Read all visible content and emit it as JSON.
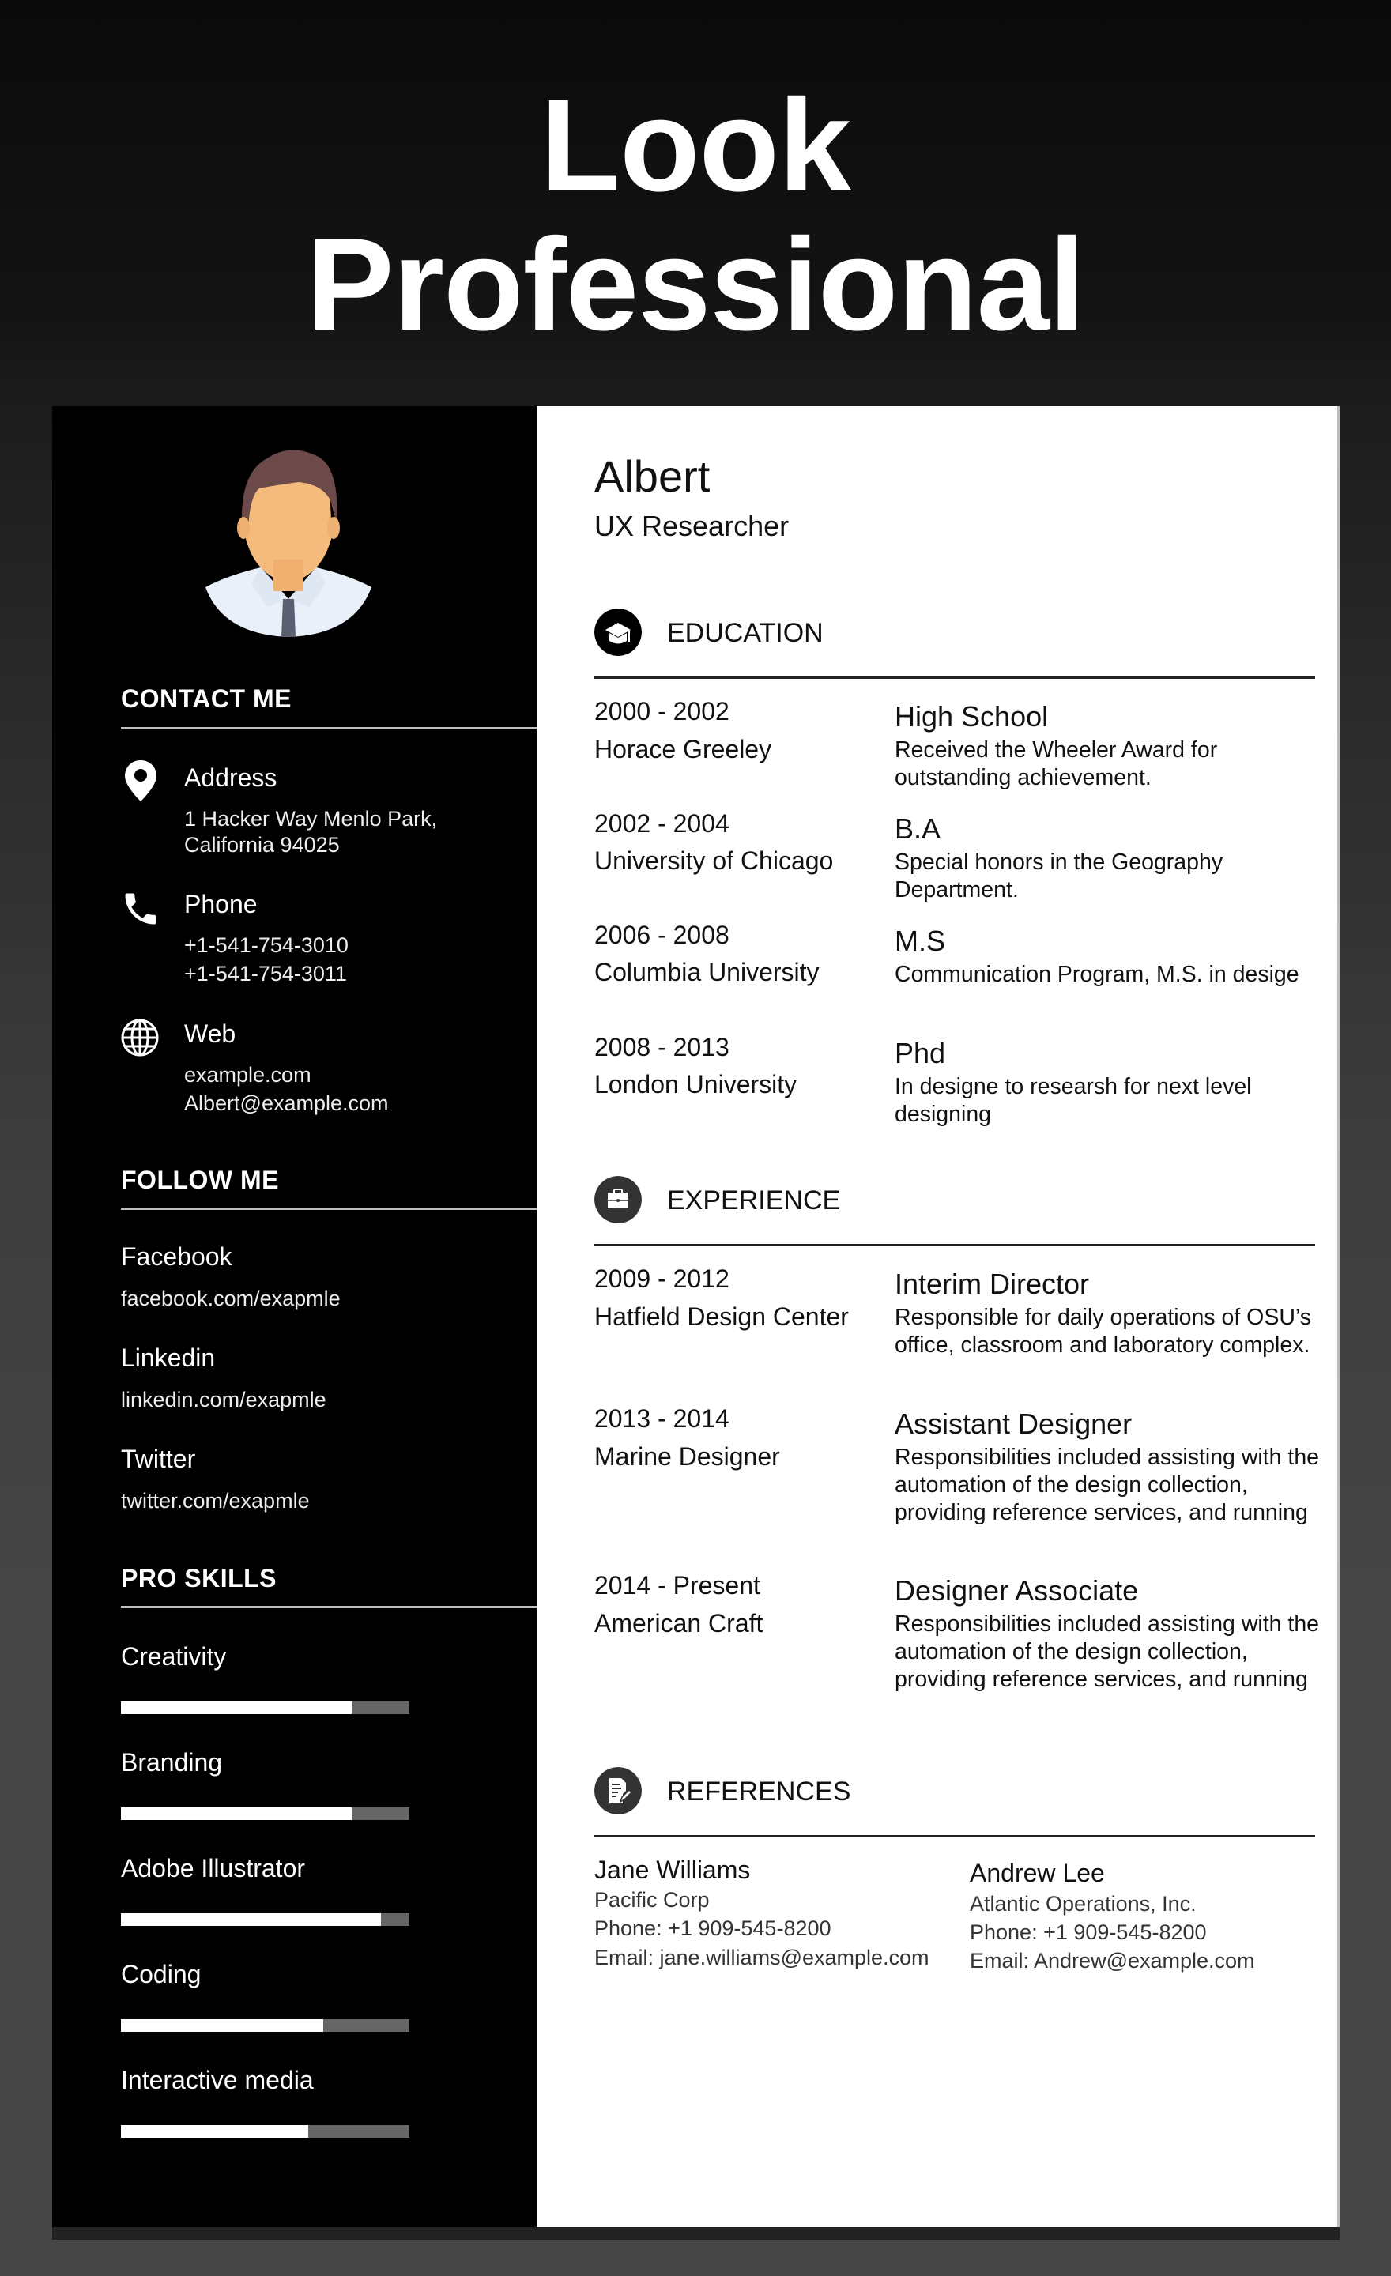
{
  "hero": {
    "line1": "Look",
    "line2": "Professional"
  },
  "profile": {
    "name": "Albert",
    "role": "UX Researcher",
    "avatar_icon": "person-avatar-icon"
  },
  "contact": {
    "heading": "CONTACT ME",
    "address": {
      "icon": "map-pin-icon",
      "label": "Address",
      "lines": [
        "1 Hacker Way Menlo Park,",
        "California 94025"
      ]
    },
    "phone": {
      "icon": "phone-icon",
      "label": "Phone",
      "lines": [
        "+1-541-754-3010",
        "+1-541-754-3011"
      ]
    },
    "web": {
      "icon": "globe-icon",
      "label": "Web",
      "lines": [
        "example.com",
        "Albert@example.com"
      ]
    }
  },
  "follow": {
    "heading": "FOLLOW ME",
    "items": [
      {
        "label": "Facebook",
        "value": "facebook.com/exapmle"
      },
      {
        "label": "Linkedin",
        "value": "linkedin.com/exapmle"
      },
      {
        "label": "Twitter",
        "value": "twitter.com/exapmle"
      }
    ]
  },
  "skills": {
    "heading": "PRO SKILLS",
    "items": [
      {
        "label": "Creativity",
        "level_percent": 80
      },
      {
        "label": "Branding",
        "level_percent": 80
      },
      {
        "label": "Adobe Illustrator",
        "level_percent": 90
      },
      {
        "label": "Coding",
        "level_percent": 70
      },
      {
        "label": "Interactive media",
        "level_percent": 65
      }
    ]
  },
  "education": {
    "heading": "EDUCATION",
    "icon": "graduation-cap-icon",
    "entries": [
      {
        "years": "2000 - 2002",
        "org": "Horace Greeley",
        "title": "High School",
        "desc": "Received the Wheeler Award for outstanding achievement."
      },
      {
        "years": "2002 - 2004",
        "org": "University of Chicago",
        "title": "B.A",
        "desc": "Special honors in the Geography Department."
      },
      {
        "years": "2006 - 2008",
        "org": "Columbia University",
        "title": "M.S",
        "desc": "Communication Program, M.S. in desige"
      },
      {
        "years": "2008 - 2013",
        "org": "London University",
        "title": "Phd",
        "desc": "In designe to researsh for next level designing"
      }
    ]
  },
  "experience": {
    "heading": "EXPERIENCE",
    "icon": "briefcase-icon",
    "entries": [
      {
        "years": "2009 - 2012",
        "org": "Hatfield Design Center",
        "title": "Interim Director",
        "desc": "Responsible for daily operations of OSU’s office, classroom and laboratory complex."
      },
      {
        "years": "2013 - 2014",
        "org": "Marine Designer",
        "title": "Assistant Designer",
        "desc": "Responsibilities included assisting with the automation of the design collection, providing reference services, and running"
      },
      {
        "years": "2014 - Present",
        "org": "American Craft",
        "title": "Designer Associate",
        "desc": "Responsibilities included assisting with the automation of the design collection, providing reference services, and running"
      }
    ]
  },
  "references": {
    "heading": "REFERENCES",
    "icon": "document-edit-icon",
    "people": [
      {
        "name": "Jane Williams",
        "company": "Pacific Corp",
        "phone": "Phone: +1 909-545-8200",
        "email": "Email: jane.williams@example.com"
      },
      {
        "name": "Andrew Lee",
        "company": "Atlantic Operations, Inc.",
        "phone": "Phone: +1 909-545-8200",
        "email": "Email: Andrew@example.com"
      }
    ]
  },
  "colors": {
    "sidebar": "#000000",
    "main": "#ffffff",
    "bar_fill": "#ffffff",
    "bar_track": "#666666",
    "education_icon": "#000000",
    "section_icon": "#333333"
  }
}
